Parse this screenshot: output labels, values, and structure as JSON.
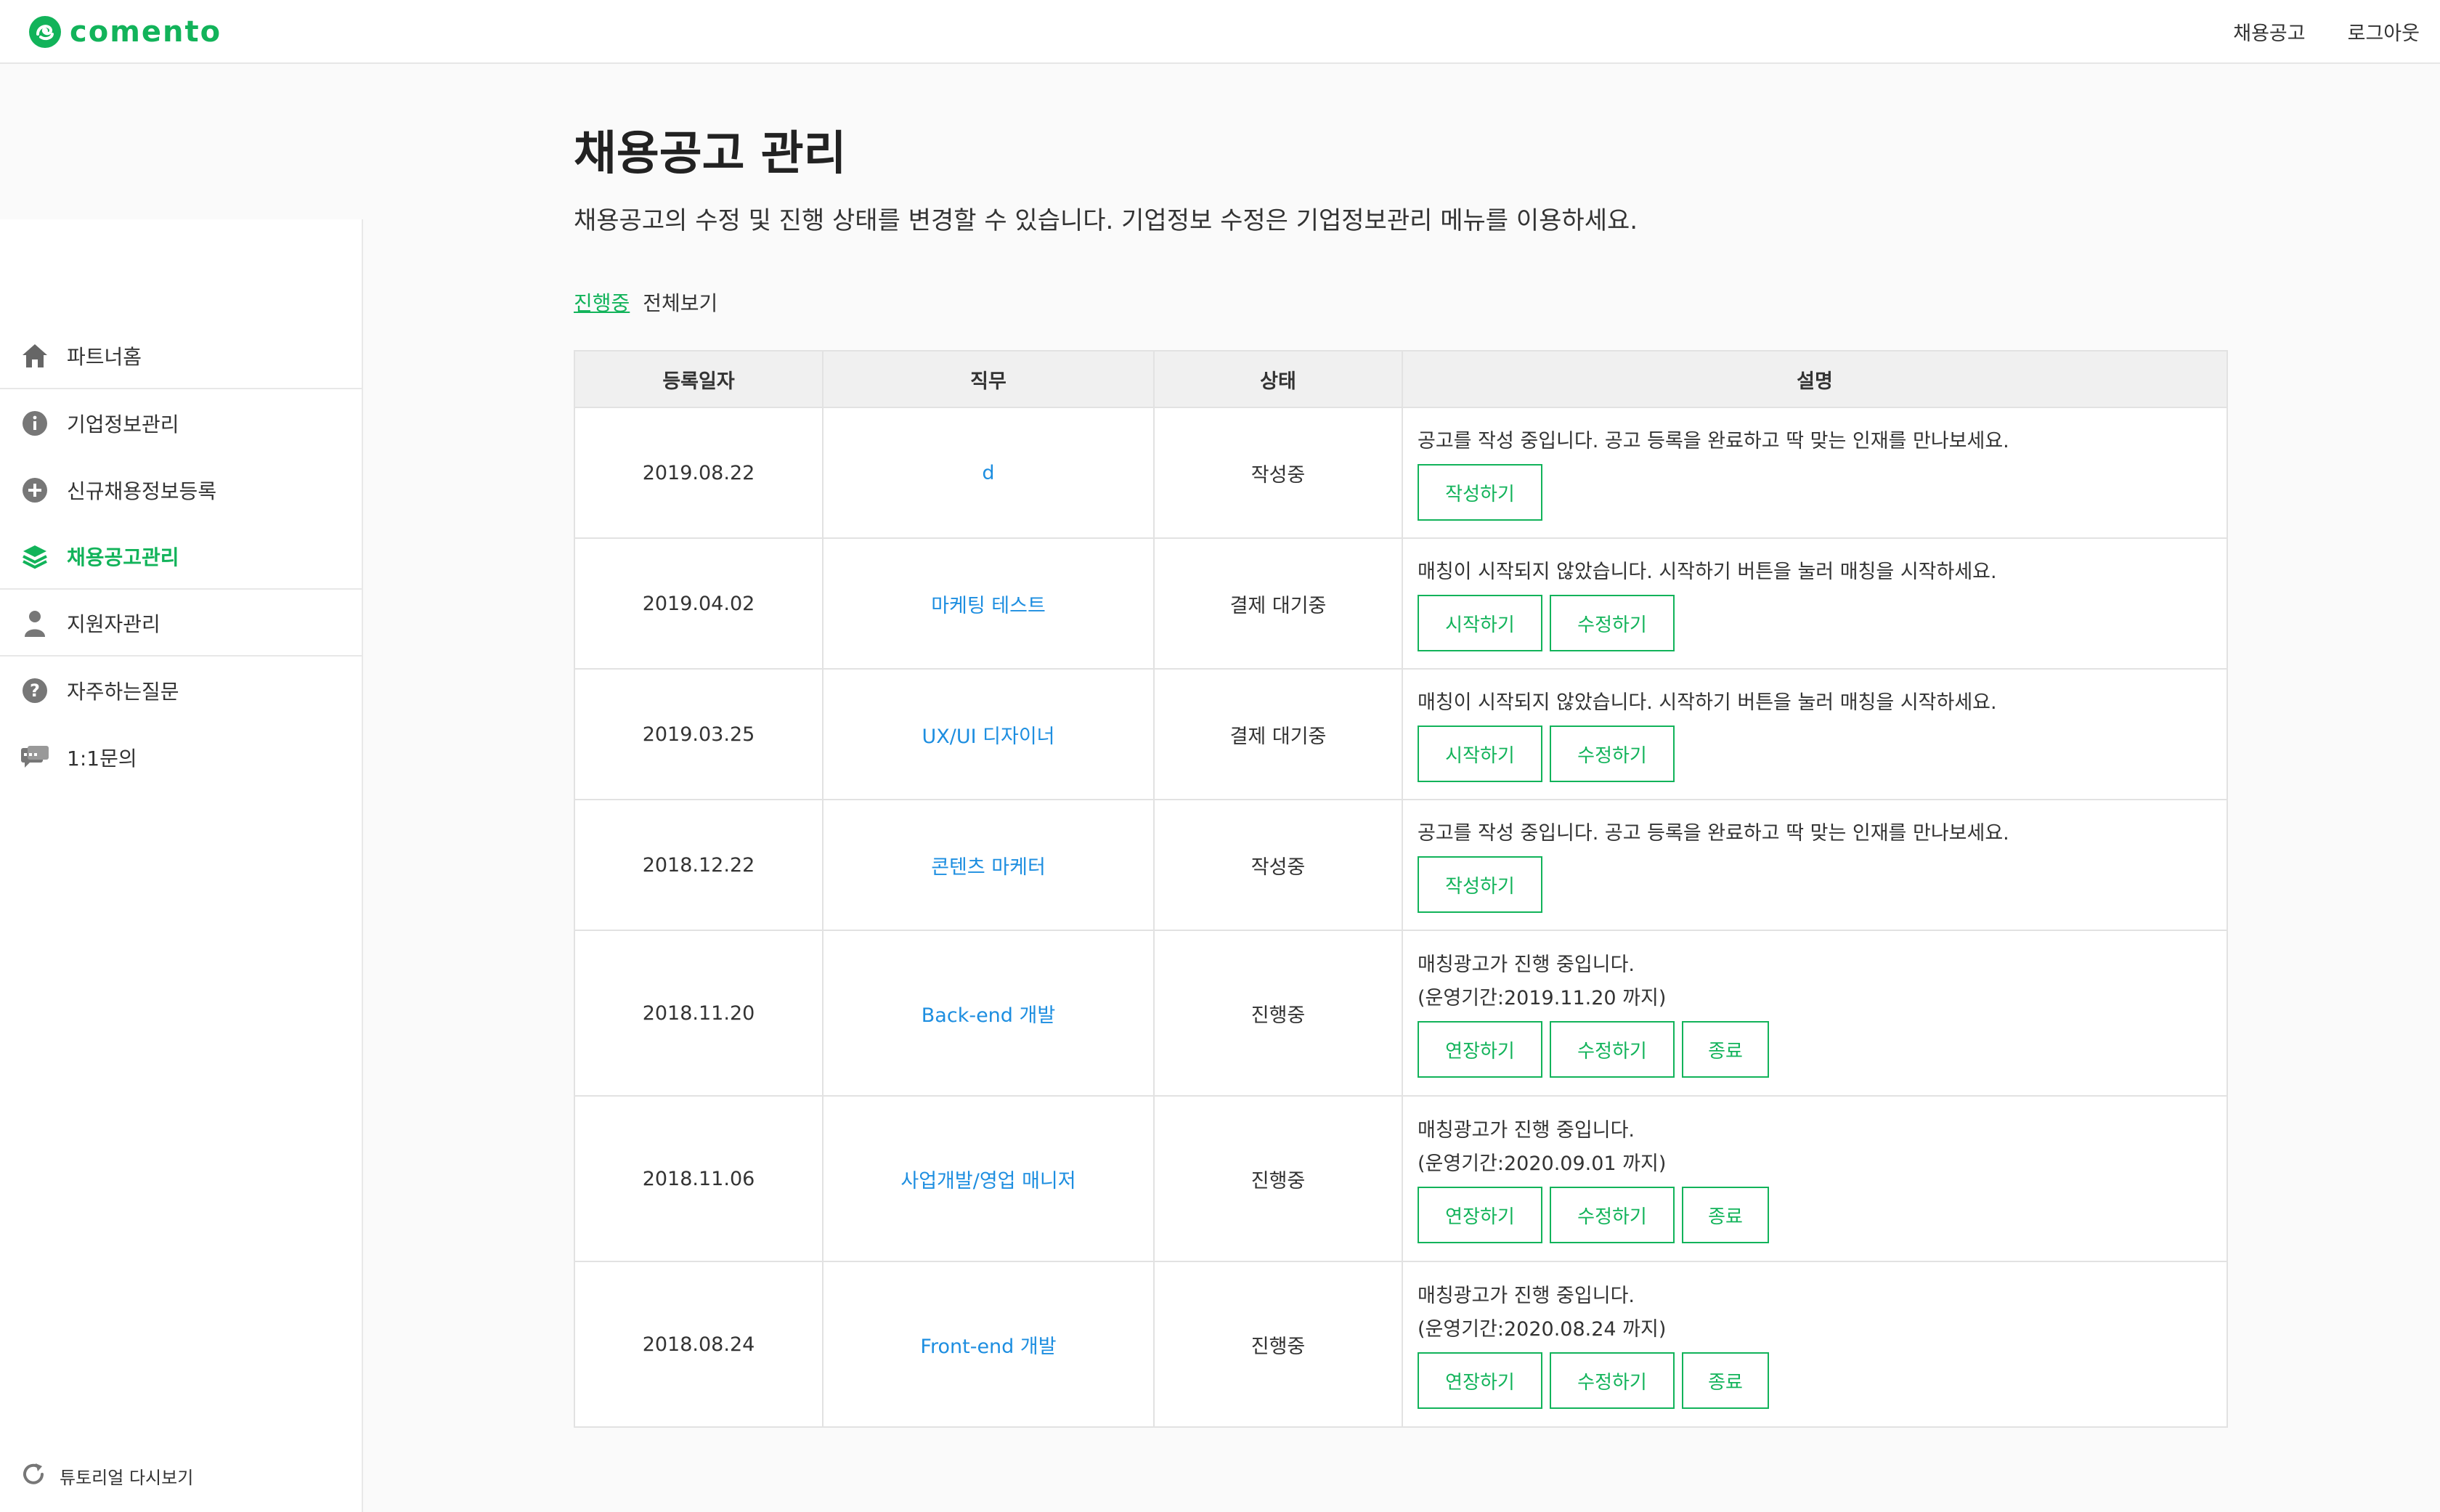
{
  "header": {
    "logo_text": "comento",
    "nav": [
      "채용공고",
      "로그아웃"
    ],
    "brand_color": "#12b35a"
  },
  "sidebar": {
    "items": [
      {
        "label": "파트너홈",
        "icon": "home-icon"
      },
      {
        "label": "기업정보관리",
        "icon": "info-icon"
      },
      {
        "label": "신규채용정보등록",
        "icon": "plus-circle-icon"
      },
      {
        "label": "채용공고관리",
        "icon": "layers-icon",
        "active": true
      },
      {
        "label": "지원자관리",
        "icon": "person-icon"
      },
      {
        "label": "자주하는질문",
        "icon": "question-icon"
      },
      {
        "label": "1:1문의",
        "icon": "chat-icon"
      }
    ],
    "tutorial": "튜토리얼 다시보기"
  },
  "main": {
    "title": "채용공고 관리",
    "description": "채용공고의 수정 및 진행 상태를 변경할 수 있습니다. 기업정보 수정은 기업정보관리 메뉴를 이용하세요.",
    "filters": {
      "in_progress": "진행중",
      "all": "전체보기"
    },
    "table": {
      "headers": [
        "등록일자",
        "직무",
        "상태",
        "설명"
      ],
      "rows": [
        {
          "date": "2019.08.22",
          "job": "d",
          "status": "작성중",
          "desc": [
            "공고를 작성 중입니다. 공고 등록을 완료하고 딱 맞는 인재를 만나보세요."
          ],
          "buttons": [
            "작성하기"
          ]
        },
        {
          "date": "2019.04.02",
          "job": "마케팅 테스트",
          "status": "결제 대기중",
          "desc": [
            "매칭이 시작되지 않았습니다. 시작하기 버튼을 눌러 매칭을 시작하세요."
          ],
          "buttons": [
            "시작하기",
            "수정하기"
          ]
        },
        {
          "date": "2019.03.25",
          "job": "UX/UI 디자이너",
          "status": "결제 대기중",
          "desc": [
            "매칭이 시작되지 않았습니다. 시작하기 버튼을 눌러 매칭을 시작하세요."
          ],
          "buttons": [
            "시작하기",
            "수정하기"
          ]
        },
        {
          "date": "2018.12.22",
          "job": "콘텐츠 마케터",
          "status": "작성중",
          "desc": [
            "공고를 작성 중입니다. 공고 등록을 완료하고 딱 맞는 인재를 만나보세요."
          ],
          "buttons": [
            "작성하기"
          ]
        },
        {
          "date": "2018.11.20",
          "job": "Back-end 개발",
          "status": "진행중",
          "desc": [
            "매칭광고가 진행 중입니다.",
            "(운영기간:2019.11.20 까지)"
          ],
          "buttons": [
            "연장하기",
            "수정하기",
            "종료"
          ]
        },
        {
          "date": "2018.11.06",
          "job": "사업개발/영업 매니저",
          "status": "진행중",
          "desc": [
            "매칭광고가 진행 중입니다.",
            "(운영기간:2020.09.01 까지)"
          ],
          "buttons": [
            "연장하기",
            "수정하기",
            "종료"
          ]
        },
        {
          "date": "2018.08.24",
          "job": "Front-end 개발",
          "status": "진행중",
          "desc": [
            "매칭광고가 진행 중입니다.",
            "(운영기간:2020.08.24 까지)"
          ],
          "buttons": [
            "연장하기",
            "수정하기",
            "종료"
          ]
        }
      ]
    }
  }
}
